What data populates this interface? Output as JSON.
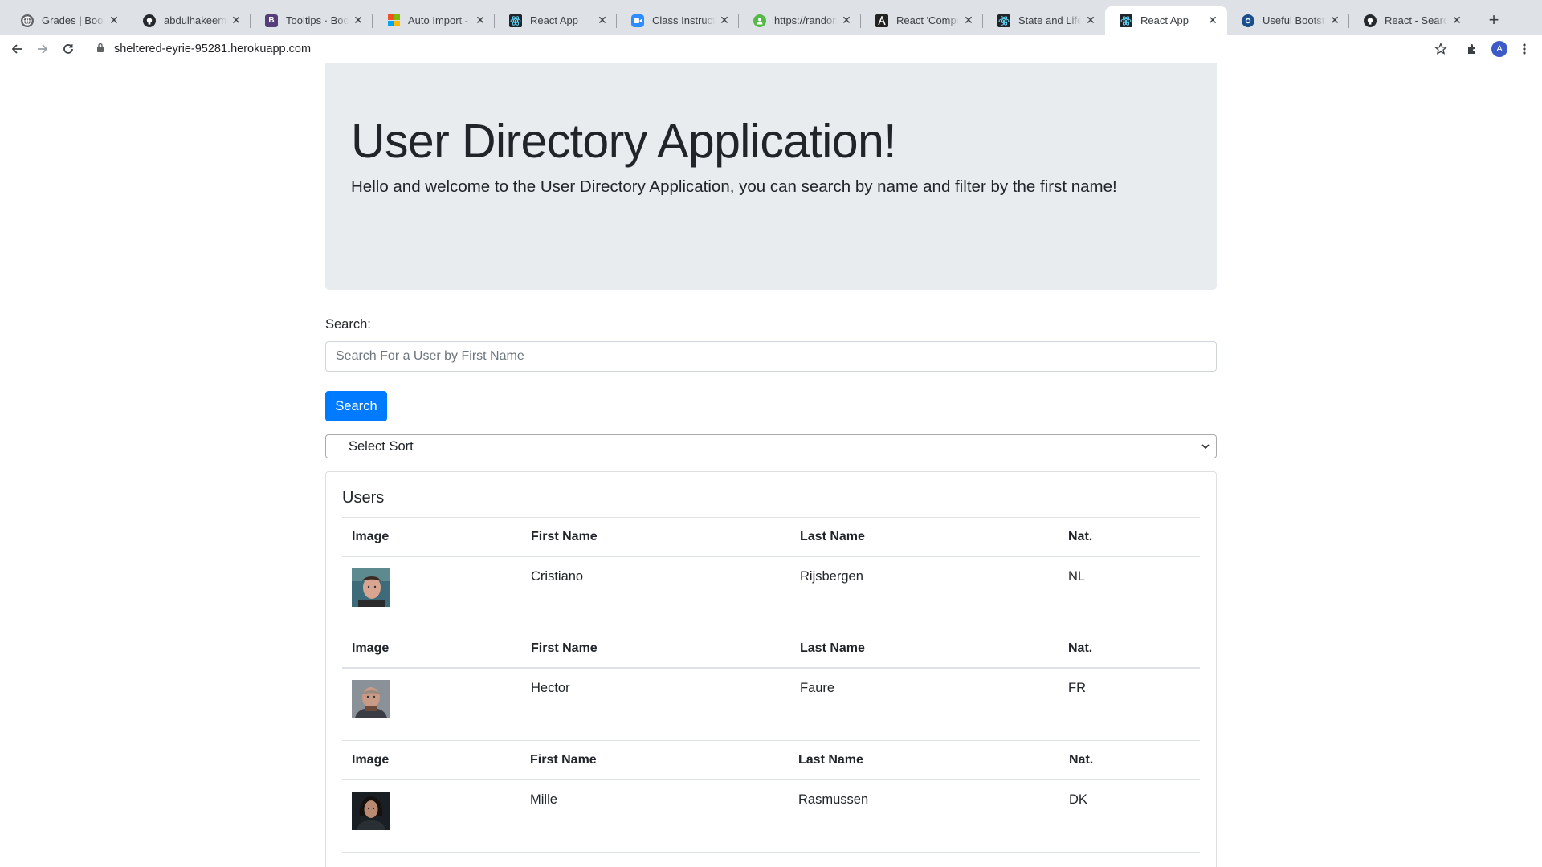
{
  "browser": {
    "tabs": [
      {
        "title": "Grades | Bootcamp",
        "icon": "globe-icon",
        "color": "#5f6368"
      },
      {
        "title": "abdulhakeemdev",
        "icon": "github-icon",
        "color": "#24292e"
      },
      {
        "title": "Tooltips · Bootstrap",
        "icon": "bootstrap-icon",
        "color": "#563d7c"
      },
      {
        "title": "Auto Import - Extension",
        "icon": "microsoft-icon",
        "color": "#f25022"
      },
      {
        "title": "React App",
        "icon": "react-icon",
        "color": "#20232a"
      },
      {
        "title": "Class Instructor",
        "icon": "zoom-icon",
        "color": "#2d8cff"
      },
      {
        "title": "https://randomuser.me",
        "icon": "randomuser-icon",
        "color": "#54b948"
      },
      {
        "title": "React 'Components'",
        "icon": "a-icon",
        "color": "#222222"
      },
      {
        "title": "State and Lifecycle",
        "icon": "react-icon",
        "color": "#20232a"
      },
      {
        "title": "React App",
        "icon": "react-icon",
        "color": "#20232a"
      },
      {
        "title": "Useful Bootstrap",
        "icon": "circle-logo-icon",
        "color": "#1a4f8b"
      },
      {
        "title": "React - Searching",
        "icon": "github-icon",
        "color": "#24292e"
      }
    ],
    "active_tab_index": 9,
    "url": "sheltered-eyrie-95281.herokuapp.com",
    "profile_initial": "A"
  },
  "jumbotron": {
    "title": "User Directory Application!",
    "lead": "Hello and welcome to the User Directory Application, you can search by name and filter by the first name!"
  },
  "search": {
    "label": "Search:",
    "placeholder": "Search For a User by First Name",
    "value": "",
    "button_label": "Search"
  },
  "sort": {
    "selected": "Select Sort"
  },
  "users": {
    "title": "Users",
    "columns": [
      "Image",
      "First Name",
      "Last Name",
      "Nat."
    ],
    "rows": [
      {
        "first": "Cristiano",
        "last": "Rijsbergen",
        "nat": "NL"
      },
      {
        "first": "Hector",
        "last": "Faure",
        "nat": "FR"
      },
      {
        "first": "Mille",
        "last": "Rasmussen",
        "nat": "DK"
      }
    ]
  },
  "colors": {
    "primary": "#007bff",
    "jumbotron_bg": "#e9ecef",
    "tabbar_bg": "#dee1e6"
  }
}
